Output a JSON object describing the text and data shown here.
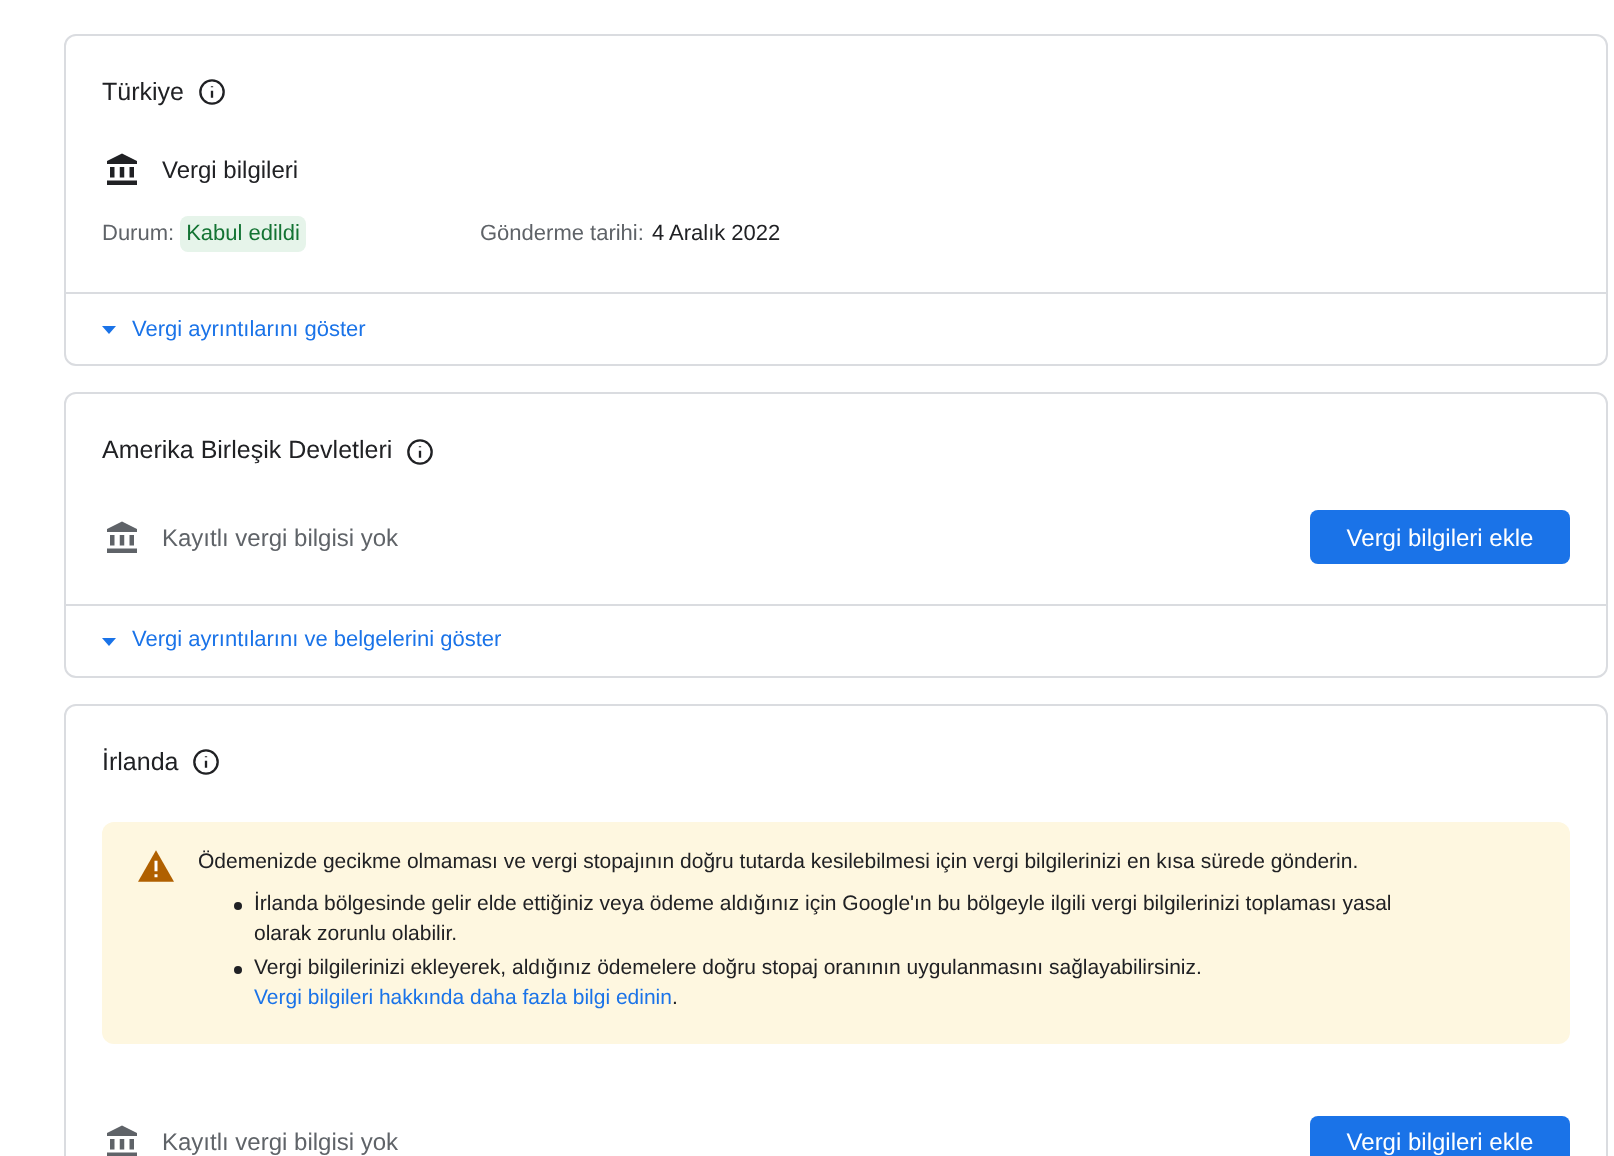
{
  "cards": [
    {
      "country": "Türkiye",
      "tax_row": {
        "kind": "submitted",
        "label": "Vergi bilgileri",
        "status_label": "Durum:",
        "status": "Kabul edildi",
        "date_label": "Gönderme tarihi:",
        "date": "4 Aralık 2022"
      },
      "expand_link": "Vergi ayrıntılarını göster"
    },
    {
      "country": "Amerika Birleşik Devletleri",
      "tax_row": {
        "kind": "empty",
        "label": "Kayıtlı vergi bilgisi yok",
        "button": "Vergi bilgileri ekle"
      },
      "expand_link": "Vergi ayrıntılarını ve belgelerini göster"
    },
    {
      "country": "İrlanda",
      "warning": {
        "title": "Ödemenizde gecikme olmaması ve vergi stopajının doğru tutarda kesilebilmesi için vergi bilgilerinizi en kısa sürede gönderin.",
        "bullets": [
          {
            "text": "İrlanda bölgesinde gelir elde ettiğiniz veya ödeme aldığınız için Google'ın bu bölgeyle ilgili vergi bilgilerinizi toplaması yasal olarak zorunlu olabilir."
          },
          {
            "text": "Vergi bilgilerinizi ekleyerek, aldığınız ödemelere doğru stopaj oranının uygulanmasını sağlayabilirsiniz.",
            "link": "Vergi bilgileri hakkında daha fazla bilgi edinin",
            "after": "."
          }
        ]
      },
      "tax_row": {
        "kind": "empty",
        "label": "Kayıtlı vergi bilgisi yok",
        "button": "Vergi bilgileri ekle"
      }
    }
  ]
}
